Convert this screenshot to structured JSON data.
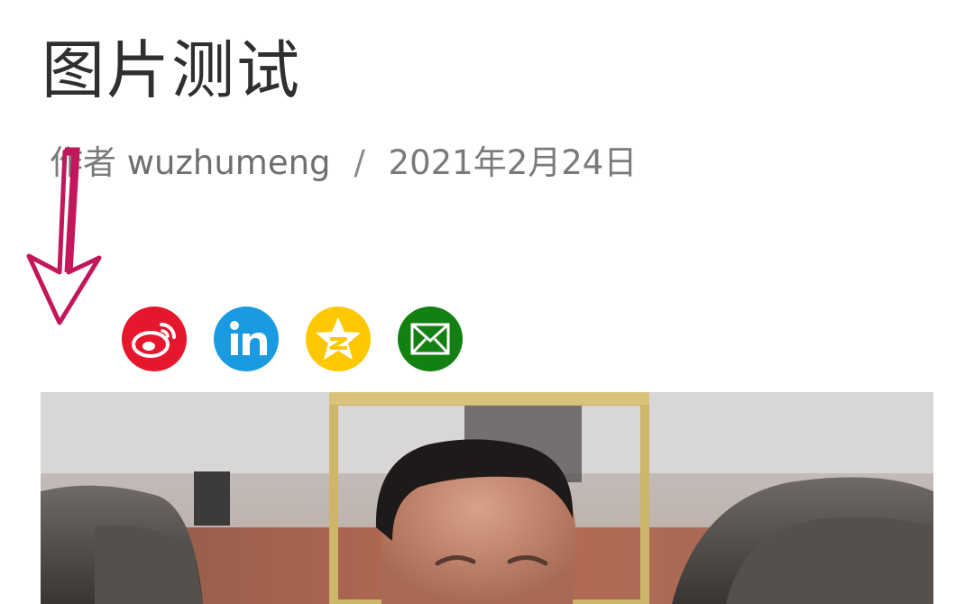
{
  "post": {
    "title": "图片测试",
    "author_prefix": "作者",
    "author": "wuzhumeng",
    "separator": "/",
    "date": "2021年2月24日"
  },
  "share_buttons": [
    {
      "name": "weibo",
      "icon": "weibo-icon",
      "color": "#e6162d"
    },
    {
      "name": "linkedin",
      "icon": "linkedin-icon",
      "color": "#1a9ae0"
    },
    {
      "name": "qzone",
      "icon": "qzone-star-icon",
      "color": "#fdc800"
    },
    {
      "name": "email",
      "icon": "envelope-icon",
      "color": "#138012"
    }
  ],
  "annotation": {
    "icon": "down-arrow-icon",
    "color": "#c2185b"
  },
  "featured_image": {
    "subject": "photo"
  }
}
